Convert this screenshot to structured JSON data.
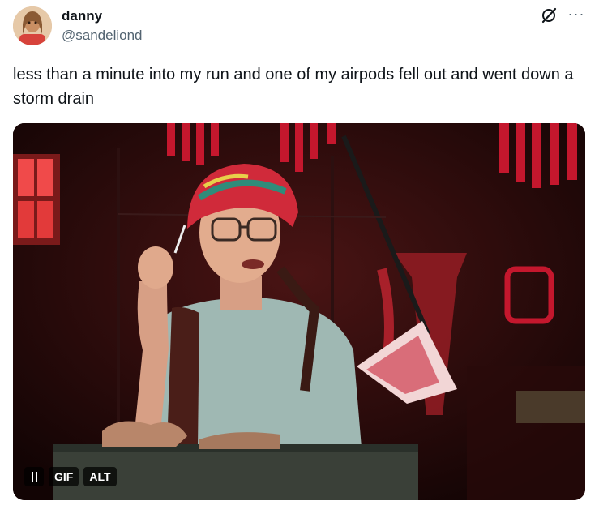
{
  "author": {
    "name": "danny",
    "handle": "@sandeliond"
  },
  "tweet": {
    "text": "less than a minute into my run and one of my airpods fell out and went down a storm drain"
  },
  "media": {
    "type": "gif",
    "controls": {
      "pause_icon": "pause-icon",
      "gif_label": "GIF",
      "alt_label": "ALT"
    }
  },
  "icons": {
    "grok": "grok-icon",
    "more": "more-icon"
  },
  "colors": {
    "text": "#0f1419",
    "secondary": "#536471",
    "scene_red": "#c4172d"
  }
}
